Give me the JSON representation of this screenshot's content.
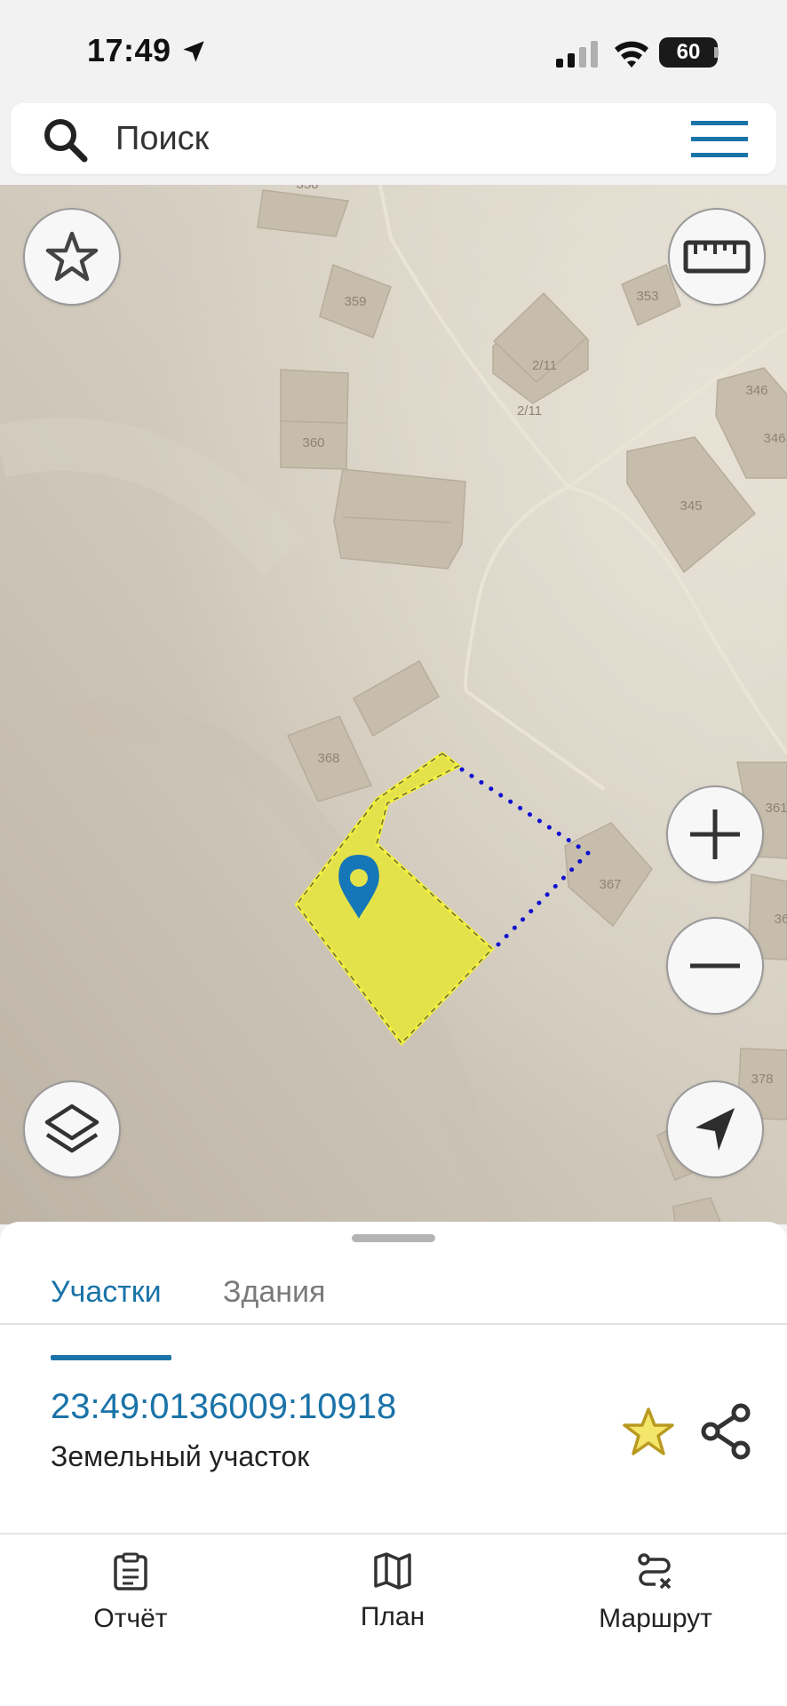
{
  "status_bar": {
    "time": "17:49",
    "battery": "60"
  },
  "search": {
    "placeholder": "Поиск"
  },
  "map": {
    "building_labels": [
      "358",
      "359",
      "353",
      "2/11",
      "2/11",
      "346",
      "346",
      "360",
      "345",
      "368",
      "367",
      "361",
      "36",
      "378"
    ],
    "selected_parcel_color": "#e4e24a",
    "boundary_dots_color": "#1010d0",
    "pin_color": "#1677b8"
  },
  "sheet": {
    "tabs": [
      {
        "label": "Участки"
      },
      {
        "label": "Здания"
      }
    ],
    "parcel": {
      "number": "23:49:0136009:10918",
      "type": "Земельный участок"
    }
  },
  "bottom_nav": [
    {
      "label": "Отчёт"
    },
    {
      "label": "План"
    },
    {
      "label": "Маршрут"
    }
  ],
  "colors": {
    "accent": "#1a73a8",
    "favorite": "#e8cc3a"
  }
}
